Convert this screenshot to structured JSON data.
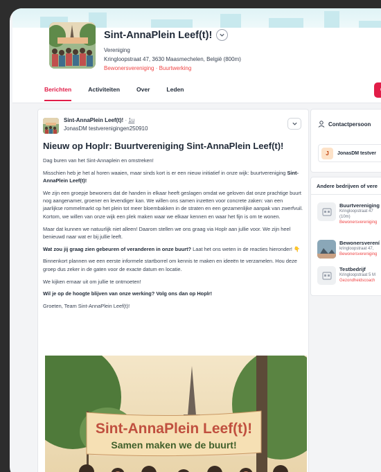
{
  "group": {
    "name": "Sint-AnnaPlein Leef(t)!",
    "type": "Vereniging",
    "address": "Kringloopstraat 47, 3630 Maasmechelen, België (800m)",
    "tags": "Bewonersvereniging · Buurtwerking",
    "photo_icon": "group-photo"
  },
  "tabs": [
    "Berichten",
    "Activiteiten",
    "Over",
    "Leden"
  ],
  "action_button_label": "C",
  "post": {
    "author": "Sint-AnnaPlein Leef(t)!",
    "time_sep": " · ",
    "time": "1u",
    "subline": "JonasDM testverenigingen250910",
    "title": "Nieuw op Hoplr: Buurtvereniging Sint-AnnaPlein Leef(t)!",
    "p1": "Dag buren van het Sint-Annaplein en omstreken!",
    "p2_a": "Misschien heb je het al horen waaien, maar sinds kort is er een nieuw initiatief in onze wijk: buurtvereniging ",
    "p2_b": "Sint-AnnaPlein Leef(t)!",
    "p3": "We zijn een groepje bewoners dat de handen in elkaar heeft geslagen omdat we geloven dat onze prachtige buurt nog aangenamer, groener en levendiger kan. We willen ons samen inzetten voor concrete zaken: van een jaarlijkse rommelmarkt op het plein tot meer bloembakken in de straten en een gezamenlijke aanpak van zwerfvuil. Kortom, we willen van onze wijk een plek maken waar we elkaar kennen en waar het fijn is om te wonen.",
    "p4": "Maar dat kunnen we natuurlijk niet alleen! Daarom stellen we ons graag via Hoplr aan jullie voor. We zijn heel benieuwd naar wat er bij jullie leeft.",
    "p5_a": "Wat zou jij graag zien gebeuren of veranderen in onze buurt?",
    "p5_b": " Laat het ons weten in de reacties hieronder! 👇",
    "p6": "Binnenkort plannen we een eerste informele startborrel om kennis te maken en ideeën te verzamelen. Hou deze groep dus zeker in de gaten voor de exacte datum en locatie.",
    "p7": "We kijken ernaar uit om jullie te ontmoeten!",
    "p8": "Wil je op de hoogte blijven van onze werking? Volg ons dan op Hoplr!",
    "p9": "Groeten, Team Sint-AnnaPlein Leef(t)!",
    "banner_line1": "Sint-AnnaPlein Leef(t)!",
    "banner_line2": "Samen maken we de buurt!"
  },
  "sidebar": {
    "contact_header": "Contactpersoon",
    "contact_initial": "J",
    "contact_name": "JonasDM testver",
    "others_header": "Andere bedrijven of vere",
    "businesses": [
      {
        "name": "Buurtvereniging",
        "address": "Kringloopstraat 47",
        "distance": "(10m)",
        "tag": "Bewonersvereniging"
      },
      {
        "name": "Bewonersverení",
        "address": "kringloopstraat 47,",
        "distance": "",
        "tag": "Bewonersvereniging"
      },
      {
        "name": "Testbedrijf",
        "address": "Kringloopstraat 5 M",
        "distance": "",
        "tag": "Gezondheidscoach"
      }
    ]
  },
  "colors": {
    "accent": "#e11d48",
    "tag_red": "#ef4444",
    "frame": "#2d2d2d"
  }
}
